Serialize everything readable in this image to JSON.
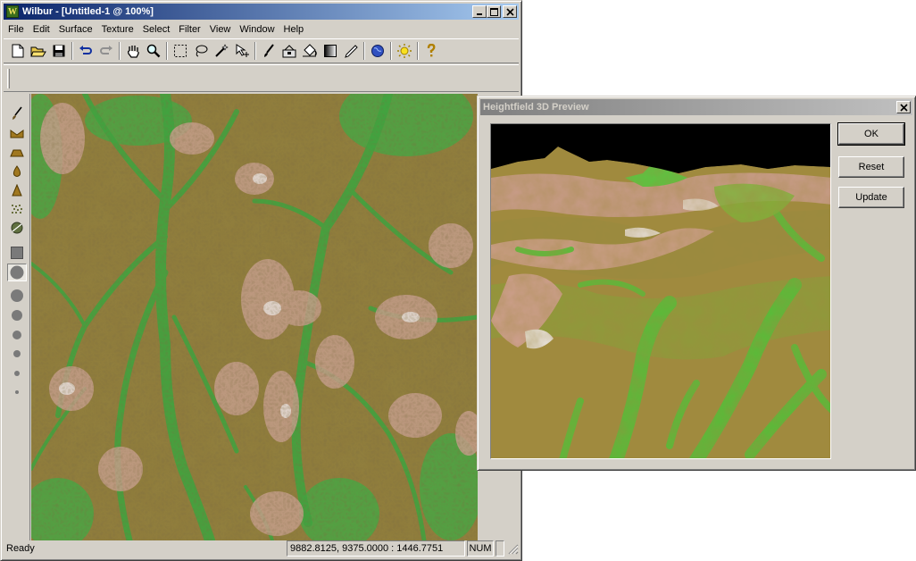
{
  "main_window": {
    "title": "Wilbur - [Untitled-1 @ 100%]",
    "app_icon_letter": "W",
    "menu": [
      "File",
      "Edit",
      "Surface",
      "Texture",
      "Select",
      "Filter",
      "View",
      "Window",
      "Help"
    ],
    "toolbar_icons": [
      "new-file-icon",
      "open-folder-icon",
      "save-disk-icon",
      "undo-icon",
      "redo-icon",
      "hand-pan-icon",
      "zoom-magnifier-icon",
      "rect-select-icon",
      "lasso-select-icon",
      "magic-wand-icon",
      "move-select-icon",
      "brush-icon",
      "fill-bucket-icon",
      "paint-bucket-icon",
      "gradient-icon",
      "pencil-icon",
      "globe-shader-icon",
      "sun-lighting-icon",
      "help-question-icon"
    ],
    "toolbox_icons": [
      "brush-tool-icon",
      "valley-tool-icon",
      "plateau-tool-icon",
      "drop-tool-icon",
      "peak-tool-icon",
      "noise-tool-icon",
      "erosion-tool-icon",
      "square-brush-icon",
      "circle-brush-xl-icon",
      "circle-brush-l-icon",
      "circle-brush-m-icon",
      "circle-brush-s-icon",
      "circle-brush-xs-icon",
      "circle-brush-xxs-icon",
      "circle-brush-tiny-icon"
    ],
    "status": {
      "ready": "Ready",
      "coords": "9882.8125, 9375.0000 : 1446.7751",
      "num": "NUM"
    }
  },
  "preview_dialog": {
    "title": "Heightfield 3D Preview",
    "ok_label": "OK",
    "reset_label": "Reset",
    "update_label": "Update"
  },
  "colors": {
    "title_active": "#0a246a",
    "title_inactive": "#808080",
    "terrain_low": "#2fae3c",
    "terrain_mid": "#8c7a3c",
    "terrain_high": "#c89a88"
  }
}
